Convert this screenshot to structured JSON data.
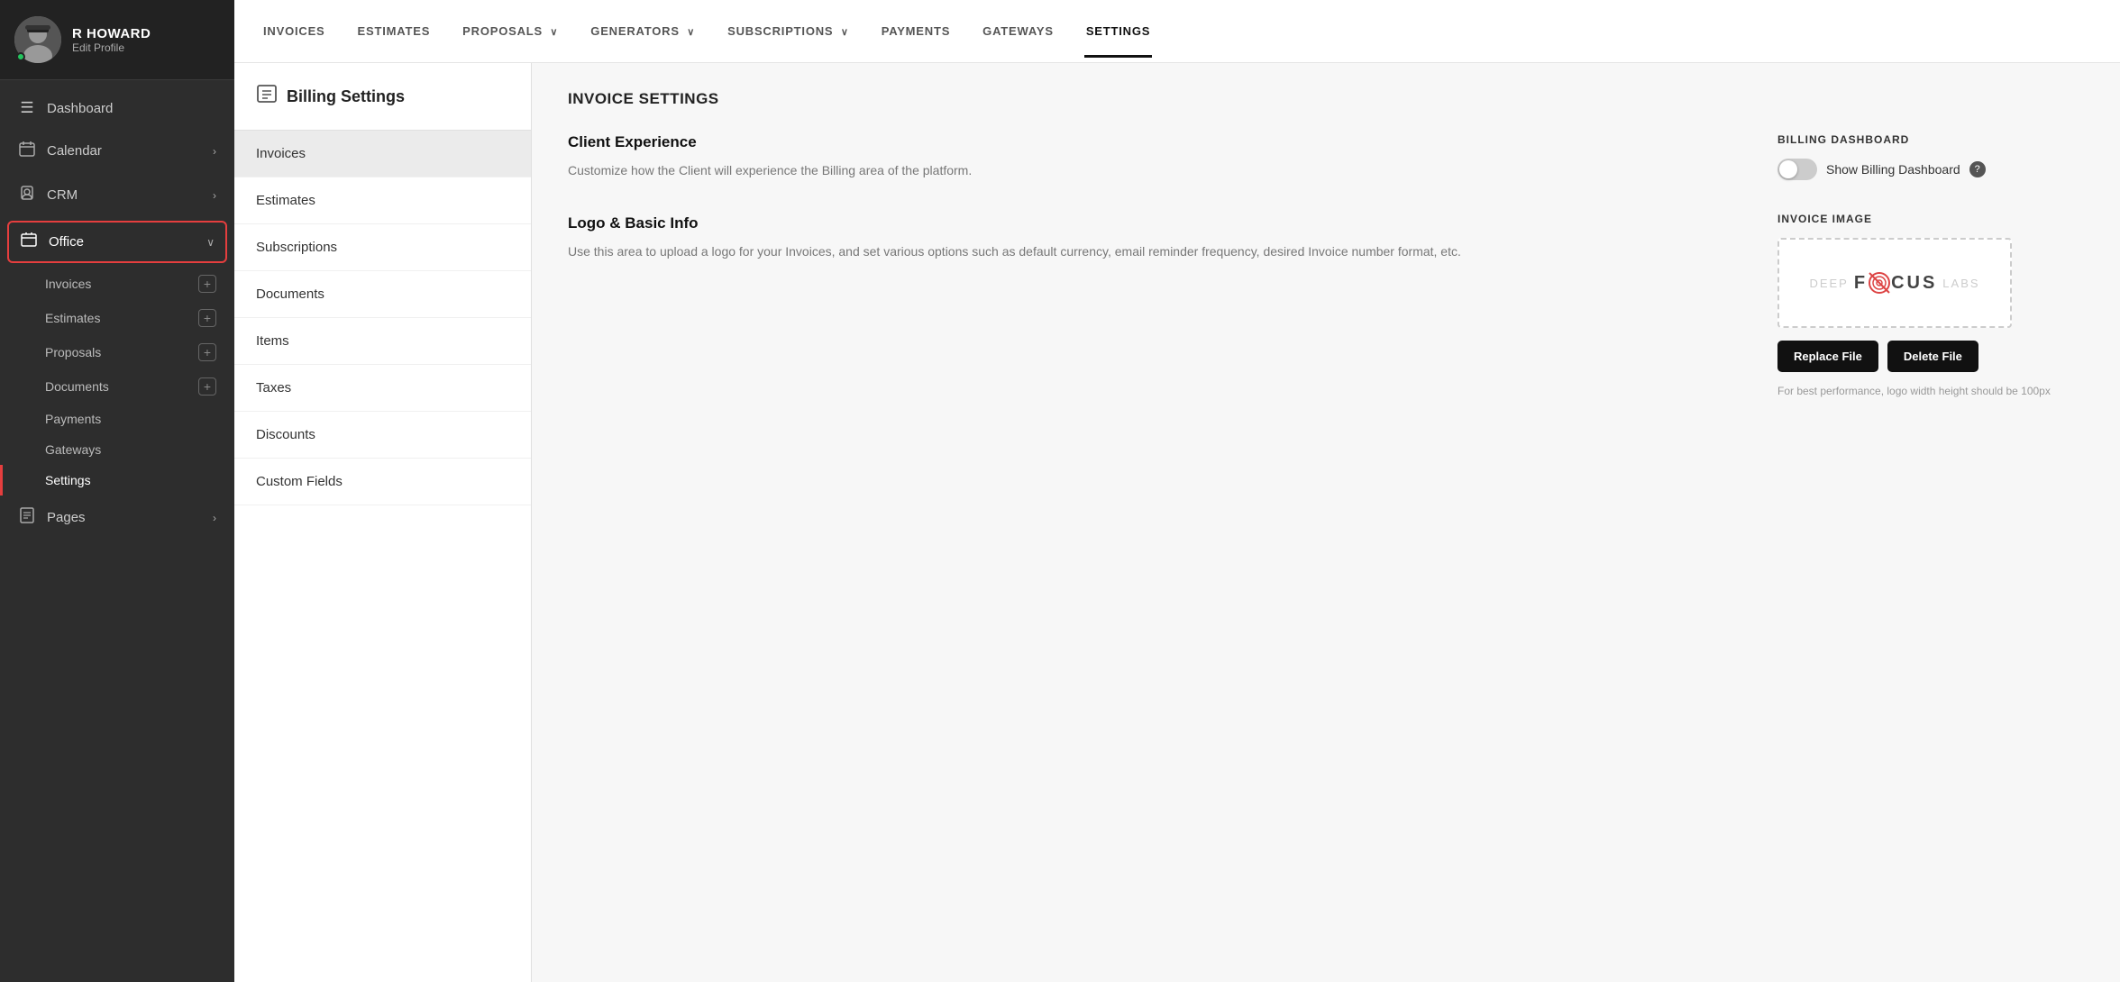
{
  "profile": {
    "name": "R HOWARD",
    "edit_label": "Edit Profile"
  },
  "sidebar": {
    "items": [
      {
        "id": "dashboard",
        "label": "Dashboard",
        "icon": "☰",
        "has_chevron": false
      },
      {
        "id": "calendar",
        "label": "Calendar",
        "icon": "📅",
        "has_chevron": true
      },
      {
        "id": "crm",
        "label": "CRM",
        "icon": "👤",
        "has_chevron": true
      },
      {
        "id": "office",
        "label": "Office",
        "icon": "📋",
        "has_chevron": true,
        "active": true
      },
      {
        "id": "pages",
        "label": "Pages",
        "icon": "📄",
        "has_chevron": true
      }
    ],
    "office_sub_items": [
      {
        "id": "invoices",
        "label": "Invoices"
      },
      {
        "id": "estimates",
        "label": "Estimates"
      },
      {
        "id": "proposals",
        "label": "Proposals"
      },
      {
        "id": "documents",
        "label": "Documents"
      },
      {
        "id": "payments",
        "label": "Payments"
      },
      {
        "id": "gateways",
        "label": "Gateways"
      },
      {
        "id": "settings",
        "label": "Settings",
        "active": true
      }
    ]
  },
  "top_nav": {
    "items": [
      {
        "id": "invoices",
        "label": "INVOICES",
        "has_dropdown": false
      },
      {
        "id": "estimates",
        "label": "ESTIMATES",
        "has_dropdown": false
      },
      {
        "id": "proposals",
        "label": "PROPOSALS",
        "has_dropdown": true
      },
      {
        "id": "generators",
        "label": "GENERATORS",
        "has_dropdown": true
      },
      {
        "id": "subscriptions",
        "label": "SUBSCRIPTIONS",
        "has_dropdown": true
      },
      {
        "id": "payments",
        "label": "PAYMENTS",
        "has_dropdown": false
      },
      {
        "id": "gateways",
        "label": "GATEWAYS",
        "has_dropdown": false
      },
      {
        "id": "settings",
        "label": "SETTINGS",
        "has_dropdown": false,
        "active": true
      }
    ]
  },
  "billing_settings": {
    "title": "Billing Settings",
    "menu_items": [
      {
        "id": "invoices",
        "label": "Invoices",
        "selected": true
      },
      {
        "id": "estimates",
        "label": "Estimates"
      },
      {
        "id": "subscriptions",
        "label": "Subscriptions"
      },
      {
        "id": "documents",
        "label": "Documents"
      },
      {
        "id": "items",
        "label": "Items"
      },
      {
        "id": "taxes",
        "label": "Taxes"
      },
      {
        "id": "discounts",
        "label": "Discounts"
      },
      {
        "id": "custom_fields",
        "label": "Custom Fields"
      }
    ]
  },
  "invoice_settings": {
    "title": "INVOICE SETTINGS",
    "sections": {
      "client_experience": {
        "title": "Client Experience",
        "description": "Customize how the Client will experience the Billing area of the platform."
      },
      "logo_basic_info": {
        "title": "Logo & Basic Info",
        "description": "Use this area to upload a logo for your Invoices, and set various options such as default currency, email reminder frequency, desired Invoice number format, etc."
      }
    },
    "billing_dashboard": {
      "section_title": "BILLING DASHBOARD",
      "toggle_label": "Show Billing Dashboard",
      "toggle_on": false
    },
    "invoice_image": {
      "section_title": "INVOICE IMAGE",
      "replace_btn": "Replace File",
      "delete_btn": "Delete File",
      "hint": "For best performance, logo width height should be 100px"
    }
  }
}
